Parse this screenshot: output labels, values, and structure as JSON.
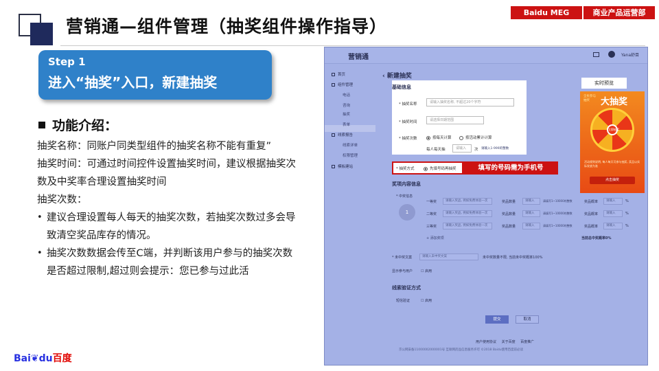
{
  "header": {
    "title": "营销通—组件管理（抽奖组件操作指导）",
    "tags": [
      "Baidu MEG",
      "商业产品运营部"
    ]
  },
  "step": {
    "number": "Step 1",
    "title": "进入“抽奖”入口，新建抽奖"
  },
  "intro": {
    "heading": "功能介绍：",
    "paragraphs": [
      "抽奖名称：同账户同类型组件的抽奖名称不能有重复”",
      "抽奖时间：可通过时间控件设置抽奖时间，建议根据抽奖次数及中奖率合理设置抽奖时间",
      "抽奖次数："
    ],
    "bullets": [
      "建议合理设置每人每天的抽奖次数，若抽奖次数过多会导致清空奖品库存的情况。",
      "抽奖次数数据会传至C端，并判断该用户参与的抽奖次数是否超过限制,超过则会提示：您已参与过此活"
    ]
  },
  "logo": {
    "text_a": "Bai",
    "text_b": "du",
    "text_c": "百度"
  },
  "screenshot": {
    "brand": "营销通",
    "user": "Yana舒目 ",
    "sidebar": {
      "items": [
        "首页",
        "组件管理",
        "电话",
        "咨询",
        "抽奖",
        "表单",
        "线索报告",
        "线索详单",
        "权限管理",
        "模板建站"
      ]
    },
    "page_title": "新建抽奖",
    "basic_title": "基础信息",
    "fields": {
      "name_label": "* 抽奖名称",
      "name_placeholder": "请输入抽奖名称, 不超过20个字符",
      "time_label": "* 抽奖时间",
      "time_placeholder": "请选择日期范围",
      "count_label": "* 抽奖次数",
      "count_opt1": "按每天计算",
      "count_opt2": "按活动累计计算",
      "daily_label": "每人每天抽",
      "daily_placeholder": "请输入",
      "daily_suffix": "次",
      "daily_hint": "请输入1-999的整数"
    },
    "method_label": "* 抽奖方式",
    "method_option": "先填号码再抽奖",
    "callout": "填写的号码需为手机号",
    "prize_title": "奖项内容信息",
    "prize_label": "* 中奖信息",
    "prize_number": "1",
    "prizes": [
      {
        "tier": "一等奖",
        "name_ph": "请输入奖品, 例如免费体验一次",
        "qty_label": "奖品数量",
        "qty_ph": "请输入",
        "qty_hint": "请填写1~10000的整数",
        "rate_label": "奖品概率",
        "rate_ph": "请输入",
        "rate_unit": "%"
      },
      {
        "tier": "二等奖",
        "name_ph": "请输入奖品, 例如免费体验一次",
        "qty_label": "奖品数量",
        "qty_ph": "请输入",
        "qty_hint": "请填写1~10000的整数",
        "rate_label": "奖品概率",
        "rate_ph": "请输入",
        "rate_unit": "%"
      },
      {
        "tier": "三等奖",
        "name_ph": "请输入奖品, 例如免费体验一次",
        "qty_label": "奖品数量",
        "qty_ph": "请输入",
        "qty_hint": "请填写1~10000的整数",
        "rate_label": "奖品概率",
        "rate_ph": "请输入",
        "rate_unit": "%"
      }
    ],
    "add_prize": "+ 添加奖项",
    "total_rate": "当前总中奖概率0%",
    "no_win_label": "* 未中奖文案",
    "no_win_placeholder": "请输入未中奖文案",
    "no_win_hint": "未中奖数量不限, 当前未中奖概率100%",
    "show_users_label": "显示参与用户",
    "show_users_opt": "启用",
    "verify_title": "线索验证方式",
    "sms_label": "短信验证",
    "sms_opt": "启用",
    "submit": "提交",
    "cancel": "取消",
    "footer_links": "用户使用协议 关于百度 百度推广",
    "footer_copy": "京公网安备11000002000001号 互联网药品信息服务许可 ©2018 Baidu使用百度前必读",
    "preview": {
      "label": "实时预览",
      "title": "大抽奖",
      "side_text": "全民参与抽奖",
      "center": "立即抽奖",
      "desc": "活动规则说明, 每人每天可参与抽奖, 奖品以实际发放为准",
      "button": "点击抽奖"
    }
  }
}
